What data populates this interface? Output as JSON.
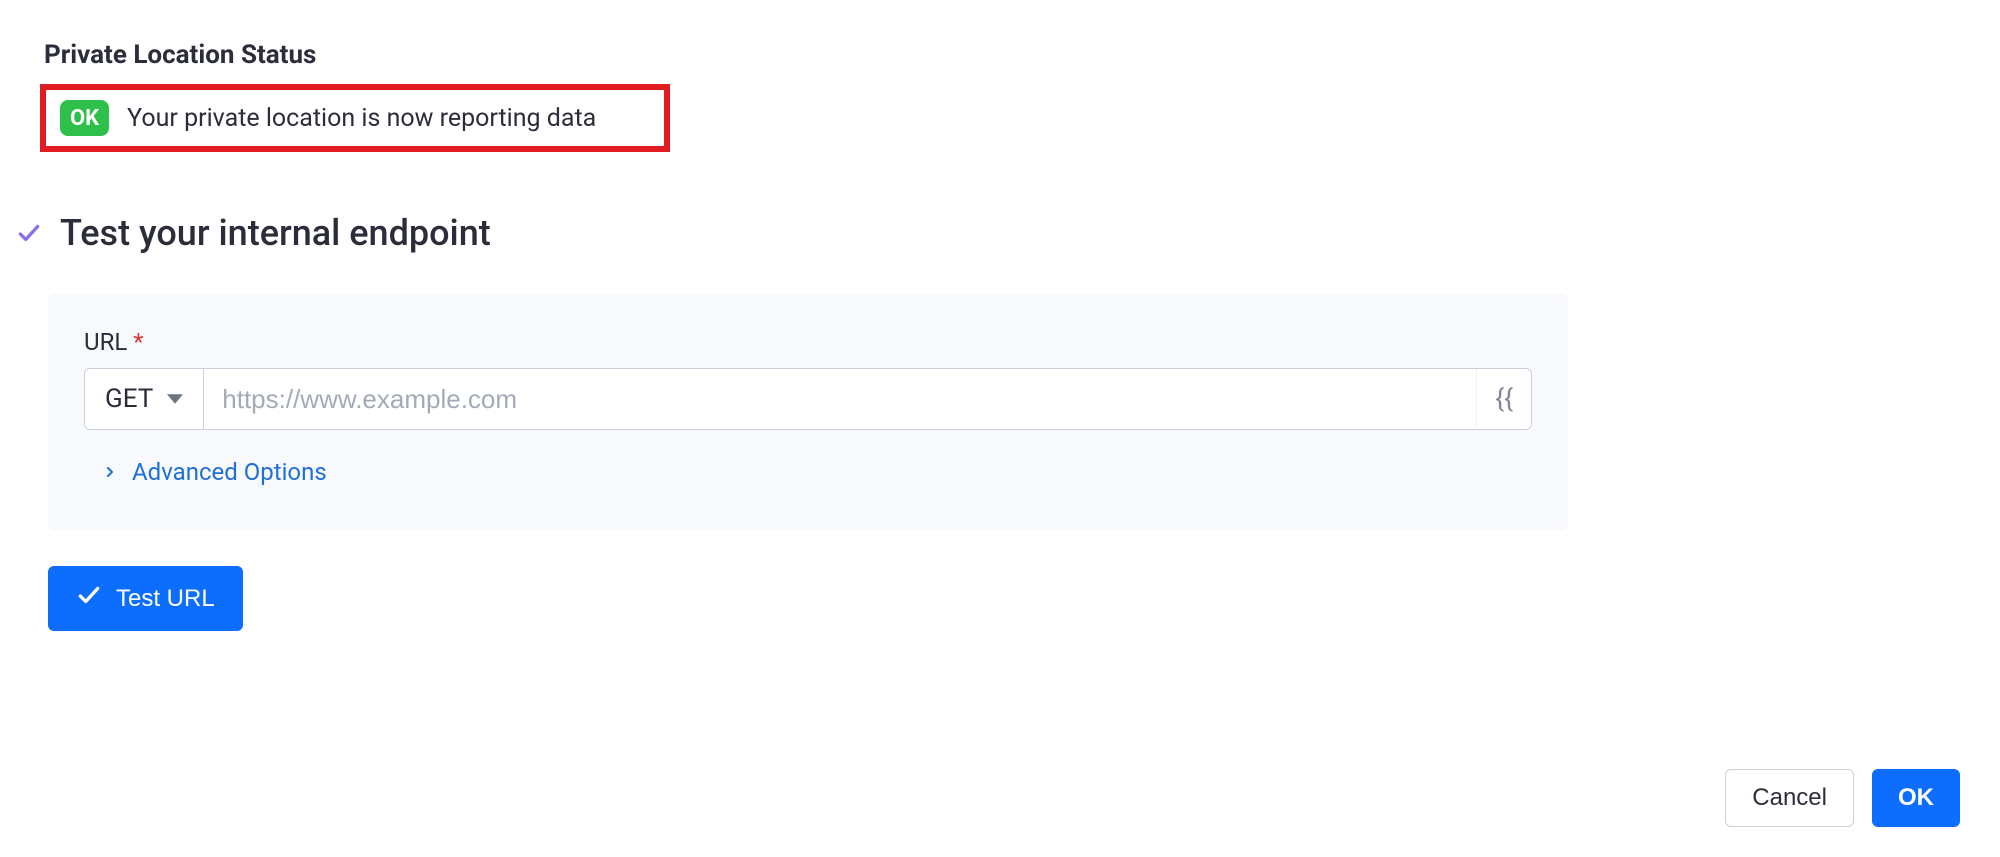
{
  "status": {
    "heading": "Private Location Status",
    "badge": "OK",
    "message": "Your private location is now reporting data"
  },
  "section": {
    "title": "Test your internal endpoint"
  },
  "form": {
    "url_label": "URL",
    "required_mark": "*",
    "method": "GET",
    "url_value": "",
    "url_placeholder": "https://www.example.com",
    "template_token": "{{",
    "advanced_label": "Advanced Options"
  },
  "buttons": {
    "test_url": "Test URL",
    "cancel": "Cancel",
    "ok": "OK"
  }
}
